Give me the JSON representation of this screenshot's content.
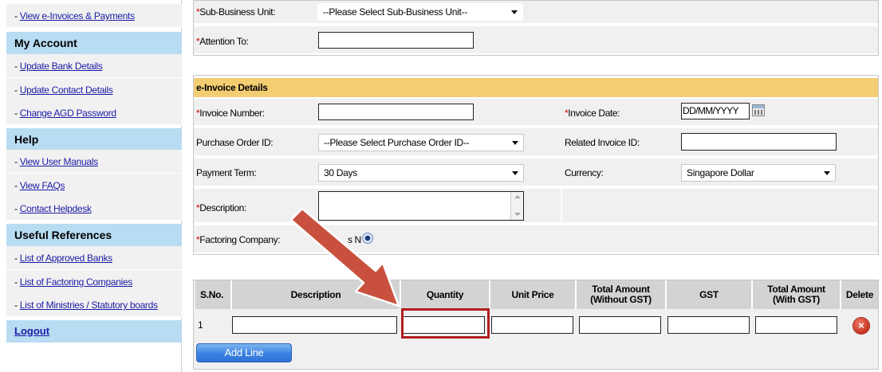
{
  "sidebar": {
    "top_link": "View e-Invoices & Payments",
    "my_account": {
      "heading": "My Account",
      "items": [
        "Update Bank Details",
        "Update Contact Details",
        "Change AGD Password"
      ]
    },
    "help": {
      "heading": "Help",
      "items": [
        "View User Manuals",
        "View FAQs",
        "Contact Helpdesk"
      ]
    },
    "useful_references": {
      "heading": "Useful References",
      "items": [
        "List of Approved Banks",
        "List of Factoring Companies",
        "List of Ministries / Statutory boards"
      ]
    },
    "logout": "Logout",
    "dash": "- "
  },
  "top_panel": {
    "sub_business_unit_label": "Sub-Business Unit:",
    "sub_business_unit_value": "--Please Select Sub-Business Unit--",
    "attention_to_label": "Attention To:",
    "required_mark": "*"
  },
  "invoice_details": {
    "header": "e-Invoice Details",
    "invoice_number_label": "Invoice Number:",
    "invoice_date_label": "Invoice Date:",
    "invoice_date_value": "DD/MM/YYYY",
    "purchase_order_label": "Purchase Order ID:",
    "purchase_order_value": "--Please Select Purchase Order ID--",
    "related_invoice_label": "Related Invoice ID:",
    "payment_term_label": "Payment Term:",
    "payment_term_value": "30 Days",
    "currency_label": "Currency:",
    "currency_value": "Singapore Dollar",
    "description_label": "Description:",
    "factoring_label": "Factoring Company:",
    "factoring_partial": "s N",
    "radio_no_label": "o"
  },
  "line_items": {
    "headers": {
      "sno": "S.No.",
      "description": "Description",
      "quantity": "Quantity",
      "unit_price": "Unit Price",
      "total_wo_gst_1": "Total Amount",
      "total_wo_gst_2": "(Without GST)",
      "gst": "GST",
      "total_w_gst_1": "Total Amount",
      "total_w_gst_2": "(With GST)",
      "delete": "Delete"
    },
    "rows": [
      {
        "sno": "1"
      }
    ],
    "add_line_label": "Add Line"
  },
  "colors": {
    "sidebar_heading_bg": "#b8dcf2",
    "section_header_bg": "#f3cd71",
    "arrow": "#c9503e",
    "highlight_box": "#b11e1e",
    "link": "#1a1aa6"
  }
}
